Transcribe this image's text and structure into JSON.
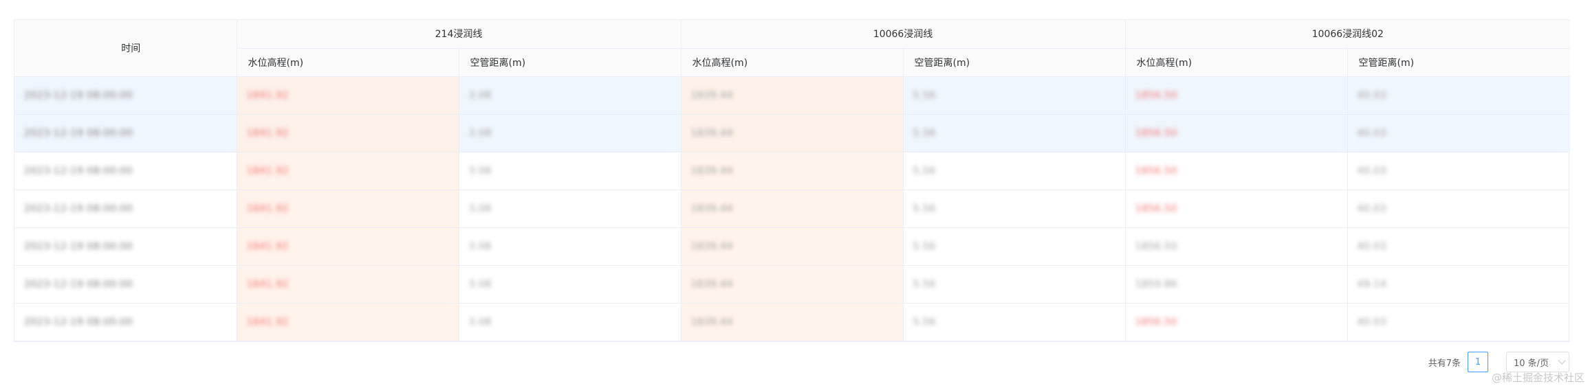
{
  "table": {
    "time_header": "时间",
    "groups": [
      "214浸润线",
      "10066浸润线",
      "10066浸润线02"
    ],
    "sub_headers": [
      "水位高程(m)",
      "空管距离(m)",
      "水位高程(m)",
      "空管距离(m)",
      "水位高程(m)",
      "空管距离(m)"
    ],
    "rows": [
      [
        "2023-12-19 08:00:00",
        "1841.92",
        "3.08",
        "1839.44",
        "5.56",
        "1856.50",
        "40.03"
      ],
      [
        "2023-12-19 08:00:00",
        "1841.92",
        "3.08",
        "1839.44",
        "5.56",
        "1856.50",
        "40.03"
      ],
      [
        "2023-12-19 08:00:00",
        "1841.92",
        "3.08",
        "1839.44",
        "5.56",
        "1856.50",
        "40.03"
      ],
      [
        "2023-12-19 08:00:00",
        "1841.92",
        "3.08",
        "1839.44",
        "5.56",
        "1856.50",
        "40.03"
      ],
      [
        "2023-12-19 08:00:00",
        "1841.92",
        "3.08",
        "1839.44",
        "5.56",
        "1856.50",
        "40.03"
      ],
      [
        "2023-12-19 08:00:00",
        "1841.92",
        "3.08",
        "1839.44",
        "5.56",
        "1859.86",
        "49.14"
      ],
      [
        "2023-12-19 08:00:00",
        "1841.92",
        "3.08",
        "1839.44",
        "5.56",
        "1856.50",
        "40.03"
      ]
    ]
  },
  "pagination": {
    "total": "共有7条",
    "current_page": "1",
    "page_size": "10 条/页"
  },
  "watermark": "@稀土掘金技术社区"
}
